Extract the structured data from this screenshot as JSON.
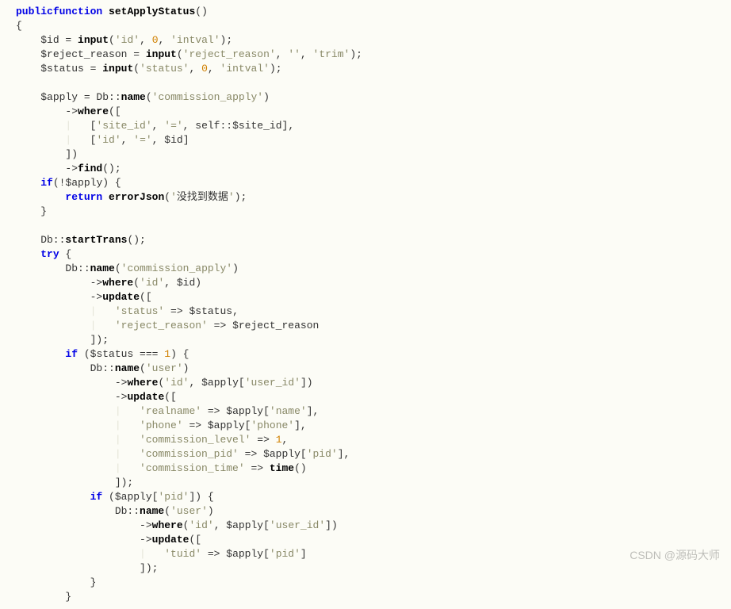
{
  "code": {
    "tokens": [
      [
        [
          "kw",
          "public"
        ],
        [
          "",
          "",
          " "
        ],
        [
          "kw",
          "function"
        ],
        [
          "",
          " "
        ],
        [
          "func",
          "setApplyStatus"
        ],
        [
          "",
          "()"
        ],
        [
          "",
          ""
        ]
      ],
      [
        [
          "",
          "{"
        ]
      ],
      [
        [
          "",
          "    "
        ],
        [
          "var",
          "$id"
        ],
        [
          "",
          " = "
        ],
        [
          "func",
          "input"
        ],
        [
          "",
          "("
        ],
        [
          "str",
          "'id'"
        ],
        [
          "",
          ", "
        ],
        [
          "num",
          "0"
        ],
        [
          "",
          ", "
        ],
        [
          "str",
          "'intval'"
        ],
        [
          "",
          ");"
        ]
      ],
      [
        [
          "",
          "    "
        ],
        [
          "var",
          "$reject_reason"
        ],
        [
          "",
          " = "
        ],
        [
          "func",
          "input"
        ],
        [
          "",
          "("
        ],
        [
          "str",
          "'reject_reason'"
        ],
        [
          "",
          ", "
        ],
        [
          "str",
          "''"
        ],
        [
          "",
          ", "
        ],
        [
          "str",
          "'trim'"
        ],
        [
          "",
          ");"
        ]
      ],
      [
        [
          "",
          "    "
        ],
        [
          "var",
          "$status"
        ],
        [
          "",
          " = "
        ],
        [
          "func",
          "input"
        ],
        [
          "",
          "("
        ],
        [
          "str",
          "'status'"
        ],
        [
          "",
          ", "
        ],
        [
          "num",
          "0"
        ],
        [
          "",
          ", "
        ],
        [
          "str",
          "'intval'"
        ],
        [
          "",
          ");"
        ]
      ],
      [
        [
          "",
          ""
        ]
      ],
      [
        [
          "",
          "    "
        ],
        [
          "var",
          "$apply"
        ],
        [
          "",
          " = Db::"
        ],
        [
          "func",
          "name"
        ],
        [
          "",
          "("
        ],
        [
          "str",
          "'commission_apply'"
        ],
        [
          "",
          ")"
        ]
      ],
      [
        [
          "",
          "        ->"
        ],
        [
          "func",
          "where"
        ],
        [
          "",
          "(["
        ]
      ],
      [
        [
          "guide",
          "        |   "
        ],
        [
          "",
          "["
        ],
        [
          "str",
          "'site_id'"
        ],
        [
          "",
          ", "
        ],
        [
          "str",
          "'='"
        ],
        [
          "",
          ", self::"
        ],
        [
          "var",
          "$site_id"
        ],
        [
          "",
          "],"
        ]
      ],
      [
        [
          "guide",
          "        |   "
        ],
        [
          "",
          "["
        ],
        [
          "str",
          "'id'"
        ],
        [
          "",
          ", "
        ],
        [
          "str",
          "'='"
        ],
        [
          "",
          ", "
        ],
        [
          "var",
          "$id"
        ],
        [
          "",
          "]"
        ]
      ],
      [
        [
          "",
          "        ])"
        ]
      ],
      [
        [
          "",
          "        ->"
        ],
        [
          "func",
          "find"
        ],
        [
          "",
          "();"
        ]
      ],
      [
        [
          "",
          "    "
        ],
        [
          "kw",
          "if"
        ],
        [
          "",
          "(!"
        ],
        [
          "var",
          "$apply"
        ],
        [
          "",
          ") {"
        ]
      ],
      [
        [
          "",
          "        "
        ],
        [
          "kw",
          "return"
        ],
        [
          "",
          " "
        ],
        [
          "func",
          "errorJson"
        ],
        [
          "",
          "("
        ],
        [
          "str",
          "'"
        ],
        [
          "cn",
          "没找到数据"
        ],
        [
          "str",
          "'"
        ],
        [
          "",
          ");"
        ]
      ],
      [
        [
          "",
          "    }"
        ]
      ],
      [
        [
          "",
          ""
        ]
      ],
      [
        [
          "",
          "    Db::"
        ],
        [
          "func",
          "startTrans"
        ],
        [
          "",
          "();"
        ]
      ],
      [
        [
          "",
          "    "
        ],
        [
          "kw",
          "try"
        ],
        [
          "",
          " {"
        ]
      ],
      [
        [
          "",
          "        Db::"
        ],
        [
          "func",
          "name"
        ],
        [
          "",
          "("
        ],
        [
          "str",
          "'commission_apply'"
        ],
        [
          "",
          ")"
        ]
      ],
      [
        [
          "",
          "            ->"
        ],
        [
          "func",
          "where"
        ],
        [
          "",
          "("
        ],
        [
          "str",
          "'id'"
        ],
        [
          "",
          ", "
        ],
        [
          "var",
          "$id"
        ],
        [
          "",
          ")"
        ]
      ],
      [
        [
          "",
          "            ->"
        ],
        [
          "func",
          "update"
        ],
        [
          "",
          "(["
        ]
      ],
      [
        [
          "guide",
          "            |   "
        ],
        [
          "str",
          "'status'"
        ],
        [
          "",
          " => "
        ],
        [
          "var",
          "$status"
        ],
        [
          "",
          ","
        ]
      ],
      [
        [
          "guide",
          "            |   "
        ],
        [
          "str",
          "'reject_reason'"
        ],
        [
          "",
          " => "
        ],
        [
          "var",
          "$reject_reason"
        ]
      ],
      [
        [
          "",
          "            ]);"
        ]
      ],
      [
        [
          "",
          "        "
        ],
        [
          "kw",
          "if"
        ],
        [
          "",
          " ("
        ],
        [
          "var",
          "$status"
        ],
        [
          "",
          " === "
        ],
        [
          "num",
          "1"
        ],
        [
          "",
          ") {"
        ]
      ],
      [
        [
          "",
          "            Db::"
        ],
        [
          "func",
          "name"
        ],
        [
          "",
          "("
        ],
        [
          "str",
          "'user'"
        ],
        [
          "",
          ")"
        ]
      ],
      [
        [
          "",
          "                ->"
        ],
        [
          "func",
          "where"
        ],
        [
          "",
          "("
        ],
        [
          "str",
          "'id'"
        ],
        [
          "",
          ", "
        ],
        [
          "var",
          "$apply"
        ],
        [
          "",
          "["
        ],
        [
          "str",
          "'user_id'"
        ],
        [
          "",
          "])"
        ]
      ],
      [
        [
          "",
          "                ->"
        ],
        [
          "func",
          "update"
        ],
        [
          "",
          "(["
        ]
      ],
      [
        [
          "guide",
          "                |   "
        ],
        [
          "str",
          "'realname'"
        ],
        [
          "",
          " => "
        ],
        [
          "var",
          "$apply"
        ],
        [
          "",
          "["
        ],
        [
          "str",
          "'name'"
        ],
        [
          "",
          "],"
        ]
      ],
      [
        [
          "guide",
          "                |   "
        ],
        [
          "str",
          "'phone'"
        ],
        [
          "",
          " => "
        ],
        [
          "var",
          "$apply"
        ],
        [
          "",
          "["
        ],
        [
          "str",
          "'phone'"
        ],
        [
          "",
          "],"
        ]
      ],
      [
        [
          "guide",
          "                |   "
        ],
        [
          "str",
          "'commission_level'"
        ],
        [
          "",
          " => "
        ],
        [
          "num",
          "1"
        ],
        [
          "",
          ","
        ]
      ],
      [
        [
          "guide",
          "                |   "
        ],
        [
          "str",
          "'commission_pid'"
        ],
        [
          "",
          " => "
        ],
        [
          "var",
          "$apply"
        ],
        [
          "",
          "["
        ],
        [
          "str",
          "'pid'"
        ],
        [
          "",
          "],"
        ]
      ],
      [
        [
          "guide",
          "                |   "
        ],
        [
          "str",
          "'commission_time'"
        ],
        [
          "",
          " => "
        ],
        [
          "func",
          "time"
        ],
        [
          "",
          "()"
        ]
      ],
      [
        [
          "",
          "                ]);"
        ]
      ],
      [
        [
          "",
          "            "
        ],
        [
          "kw",
          "if"
        ],
        [
          "",
          " ("
        ],
        [
          "var",
          "$apply"
        ],
        [
          "",
          "["
        ],
        [
          "str",
          "'pid'"
        ],
        [
          "",
          "]) {"
        ]
      ],
      [
        [
          "",
          "                Db::"
        ],
        [
          "func",
          "name"
        ],
        [
          "",
          "("
        ],
        [
          "str",
          "'user'"
        ],
        [
          "",
          ")"
        ]
      ],
      [
        [
          "",
          "                    ->"
        ],
        [
          "func",
          "where"
        ],
        [
          "",
          "("
        ],
        [
          "str",
          "'id'"
        ],
        [
          "",
          ", "
        ],
        [
          "var",
          "$apply"
        ],
        [
          "",
          "["
        ],
        [
          "str",
          "'user_id'"
        ],
        [
          "",
          "])"
        ]
      ],
      [
        [
          "",
          "                    ->"
        ],
        [
          "func",
          "update"
        ],
        [
          "",
          "(["
        ]
      ],
      [
        [
          "guide",
          "                    |   "
        ],
        [
          "str",
          "'tuid'"
        ],
        [
          "",
          " => "
        ],
        [
          "var",
          "$apply"
        ],
        [
          "",
          "["
        ],
        [
          "str",
          "'pid'"
        ],
        [
          "",
          "]"
        ]
      ],
      [
        [
          "",
          "                    ]);"
        ]
      ],
      [
        [
          "",
          "            }"
        ]
      ],
      [
        [
          "",
          "        }"
        ]
      ]
    ]
  },
  "watermark": "CSDN @源码大师"
}
